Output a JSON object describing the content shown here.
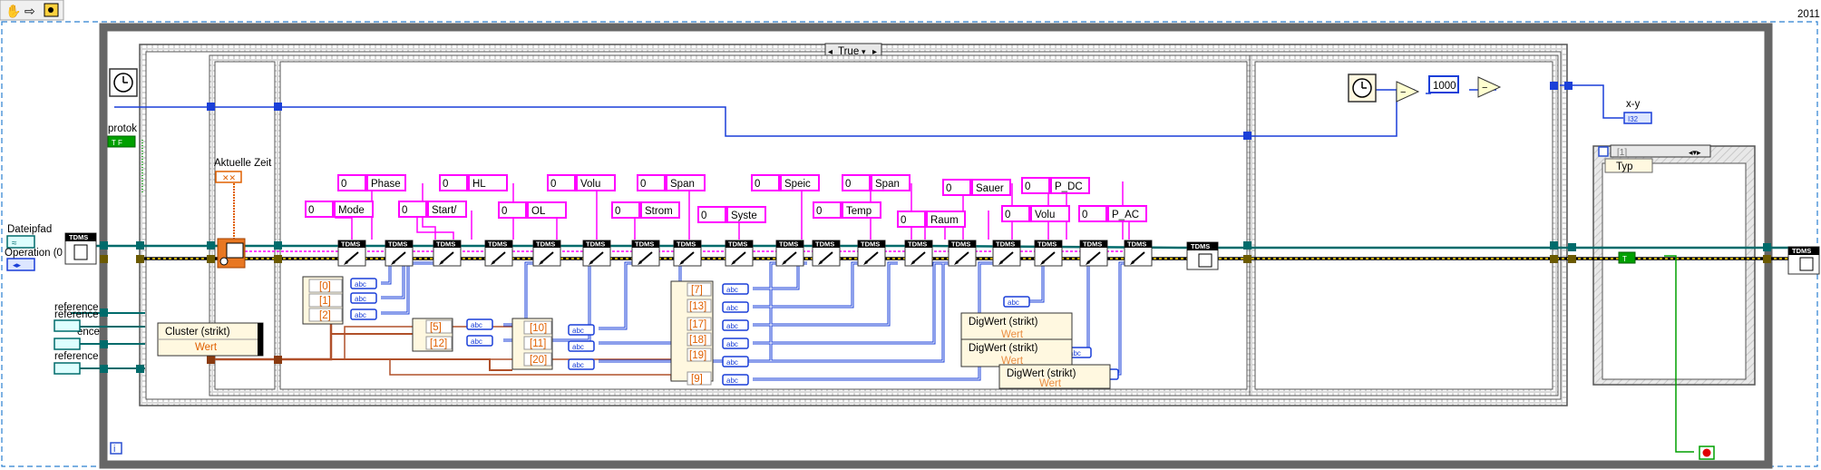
{
  "toolbar": {
    "items": [
      "hand-tool",
      "arrow-tool",
      "run-highlight"
    ]
  },
  "corner_label": "2011",
  "case_selector": {
    "value": "True"
  },
  "labels": {
    "protok": "protok",
    "tf": "T F",
    "dateipfad": "Dateipfad",
    "operation": "Operation (0",
    "reference1": "reference",
    "reference2": "reference",
    "reference3": "ence",
    "reference4": "reference",
    "aktuelle_zeit": "Aktuelle Zeit",
    "xy": "x-y",
    "i32": "I32",
    "typ": "Typ",
    "case_index": "[1]",
    "info": "i"
  },
  "bundle": {
    "cluster": "Cluster (strikt)",
    "wert": "Wert"
  },
  "constants": [
    {
      "num": "0",
      "text": "Phase"
    },
    {
      "num": "0",
      "text": "Mode"
    },
    {
      "num": "0",
      "text": "HL"
    },
    {
      "num": "0",
      "text": "Start/"
    },
    {
      "num": "0",
      "text": "Volu"
    },
    {
      "num": "0",
      "text": "OL"
    },
    {
      "num": "0",
      "text": "Span"
    },
    {
      "num": "0",
      "text": "Strom"
    },
    {
      "num": "0",
      "text": "Syste"
    },
    {
      "num": "0",
      "text": "Speic"
    },
    {
      "num": "0",
      "text": "Span"
    },
    {
      "num": "0",
      "text": "Temp"
    },
    {
      "num": "0",
      "text": "Raum"
    },
    {
      "num": "0",
      "text": "Sauer"
    },
    {
      "num": "0",
      "text": "Volu"
    },
    {
      "num": "0",
      "text": "P_DC"
    },
    {
      "num": "0",
      "text": "P_AC"
    }
  ],
  "index_a": [
    "[0]",
    "[1]",
    "[2]"
  ],
  "index_b": [
    "[5]",
    "[12]"
  ],
  "index_c": [
    "[10]",
    "[11]",
    "[20]"
  ],
  "index_d": [
    "[7]",
    "[13]",
    "[17]",
    "[18]",
    "[19]",
    "[9]"
  ],
  "dbl_tag": "abc",
  "digwert": [
    "DigWert (strikt)",
    "DigWert (strikt)",
    "DigWert (strikt)"
  ],
  "wert_label": "Wert",
  "node_text": {
    "tdms": "TDMS",
    "const_1000": "1000"
  },
  "colors": {
    "pink": "#ff00ff",
    "blue": "#0000cc",
    "teal": "#008080",
    "brown": "#b0502a",
    "orange": "#e87722",
    "frame": "#808080"
  }
}
